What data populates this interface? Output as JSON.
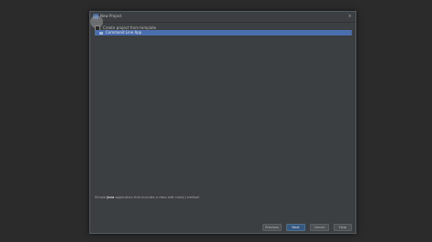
{
  "dialog": {
    "title": "New Project",
    "close_glyph": "×"
  },
  "options": {
    "create_from_template_label": "Create project from template",
    "checked": false
  },
  "templates": [
    {
      "label": "Command Line App",
      "selected": true
    }
  ],
  "description": {
    "prefix": "Simple ",
    "bold": "Java",
    "suffix": " application that includes a class with main() method"
  },
  "buttons": {
    "previous": "Previous",
    "next": "Next",
    "cancel": "Cancel",
    "help": "Help"
  },
  "colors": {
    "selection": "#4b6eaf",
    "dialog_bg": "#3c3f41",
    "backdrop": "#2b2b2b"
  }
}
